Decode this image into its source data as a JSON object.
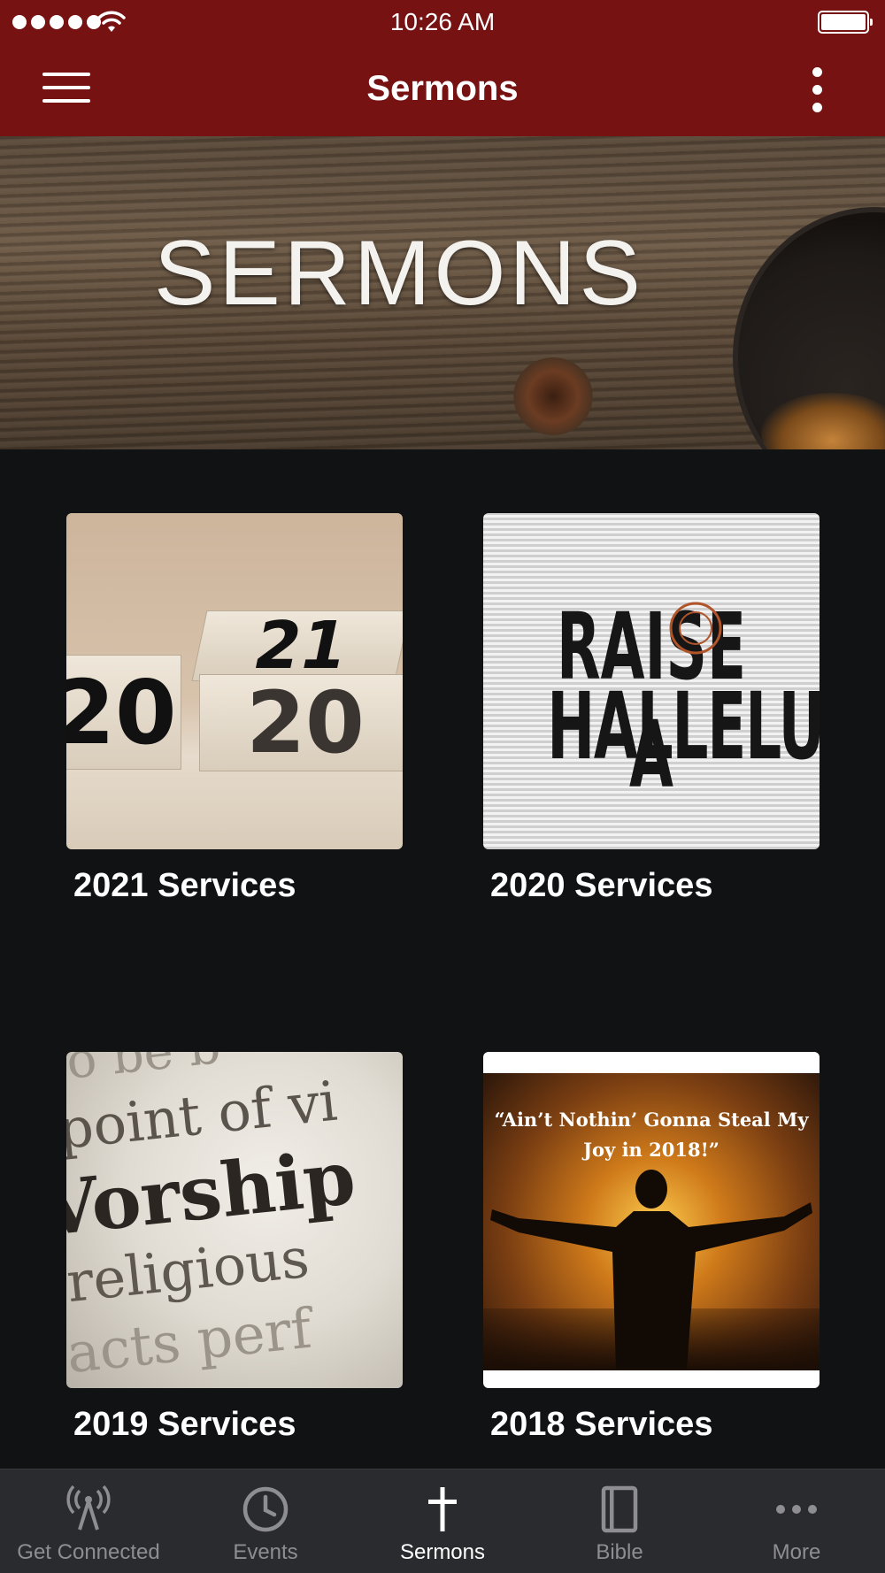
{
  "status_bar": {
    "time": "10:26 AM"
  },
  "navbar": {
    "title": "Sermons"
  },
  "banner": {
    "text": "SERMONS"
  },
  "cards": [
    {
      "label": "2021 Services",
      "thumb_text": [
        "20",
        "21",
        "20"
      ]
    },
    {
      "label": "2020 Services",
      "thumb_text": [
        "RAISE A",
        "HALLELUJAH"
      ]
    },
    {
      "label": "2019 Services",
      "thumb_text": [
        "o be b",
        "point of vi",
        "Vorship",
        "religious",
        "acts perf"
      ]
    },
    {
      "label": "2018 Services",
      "thumb_text": [
        "“Ain’t Nothin’ Gonna Steal My",
        "Joy in 2018!”"
      ]
    }
  ],
  "tabs": [
    {
      "label": "Get Connected",
      "icon": "broadcast-tower-icon",
      "active": false
    },
    {
      "label": "Events",
      "icon": "clock-icon",
      "active": false
    },
    {
      "label": "Sermons",
      "icon": "cross-icon",
      "active": true
    },
    {
      "label": "Bible",
      "icon": "book-icon",
      "active": false
    },
    {
      "label": "More",
      "icon": "more-dots-icon",
      "active": false
    }
  ],
  "colors": {
    "navbar": "#771213",
    "background": "#111214",
    "tabbar": "#2a2b2e",
    "tab_inactive": "#8e8e92",
    "tab_active": "#ffffff"
  }
}
